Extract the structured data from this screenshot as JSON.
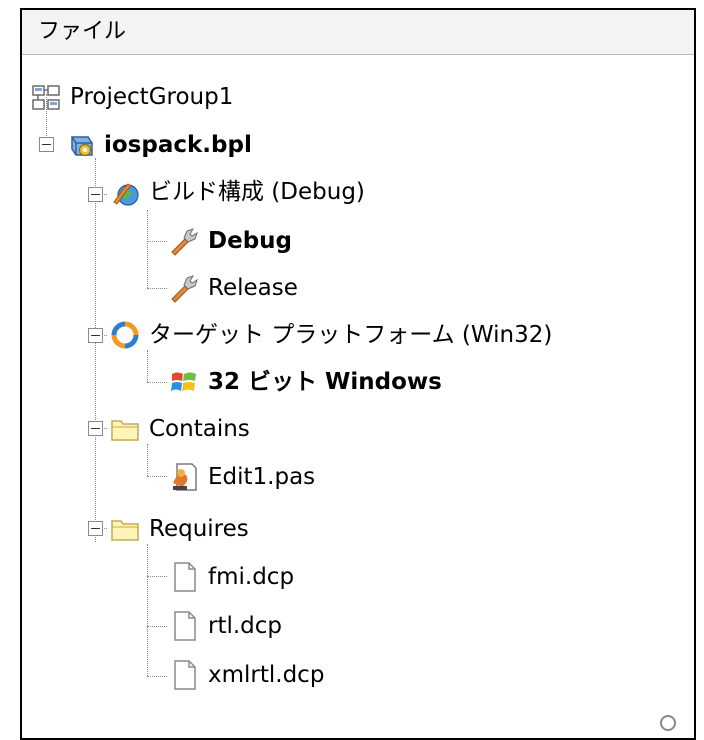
{
  "panel": {
    "title": "ファイル"
  },
  "tree": {
    "project_group": "ProjectGroup1",
    "package": "iospack.bpl",
    "build_config": "ビルド構成 (Debug)",
    "debug": "Debug",
    "release": "Release",
    "target_platform": "ターゲット プラットフォーム (Win32)",
    "windows32": "32 ビット Windows",
    "contains": "Contains",
    "edit_pas": "Edit1.pas",
    "requires": "Requires",
    "fmi": "fmi.dcp",
    "rtl": "rtl.dcp",
    "xmlrtl": "xmlrtl.dcp"
  },
  "icons": {
    "project_group": "project-group-icon",
    "package": "package-gear-icon",
    "build_config": "build-config-icon",
    "config": "wrench-icon",
    "platform": "platform-ring-icon",
    "windows": "windows-logo-icon",
    "folder": "folder-icon",
    "pas_file": "pascal-file-icon",
    "dcp_file": "file-icon"
  },
  "colors": {
    "folder": "#fff5b8",
    "folder_border": "#c7a94d",
    "ring_orange": "#f29b1f",
    "ring_blue": "#2d7fd3",
    "wrench": "#e08a3a"
  }
}
